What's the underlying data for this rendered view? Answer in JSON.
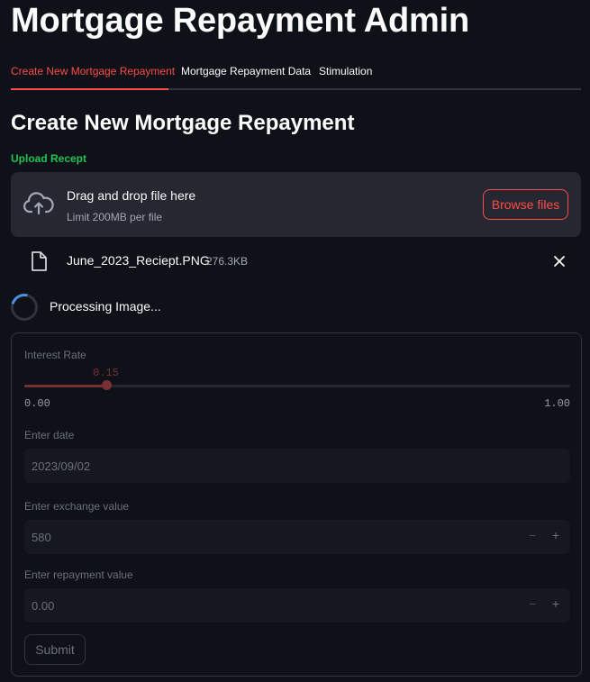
{
  "header": {
    "title": "Mortgage Repayment Admin"
  },
  "tabs": [
    {
      "label": "Create New Mortgage Repayment",
      "active": true
    },
    {
      "label": "Mortgage Repayment Data",
      "active": false
    },
    {
      "label": "Stimulation",
      "active": false
    }
  ],
  "section": {
    "title": "Create New Mortgage Repayment"
  },
  "uploader": {
    "label": "Upload Recept",
    "drop_text": "Drag and drop file here",
    "limit_text": "Limit 200MB per file",
    "browse_label": "Browse files",
    "icon": "cloud-upload-icon"
  },
  "file": {
    "name": "June_2023_Reciept.PNG",
    "size": "276.3KB",
    "icon": "file-icon"
  },
  "status": {
    "text": "Processing Image..."
  },
  "form": {
    "interest_rate": {
      "label": "Interest Rate",
      "value": "0.15",
      "min": "0.00",
      "max": "1.00",
      "fraction": 0.15
    },
    "date": {
      "label": "Enter date",
      "value": "2023/09/02"
    },
    "exchange": {
      "label": "Enter exchange value",
      "value": "580",
      "minus": "−",
      "plus": "+"
    },
    "repayment": {
      "label": "Enter repayment value",
      "value": "0.00",
      "minus": "−",
      "plus": "+"
    },
    "submit_label": "Submit"
  },
  "colors": {
    "accent": "#ff4b4b",
    "success": "#21c354",
    "background": "#0e1117",
    "surface": "#262730"
  }
}
